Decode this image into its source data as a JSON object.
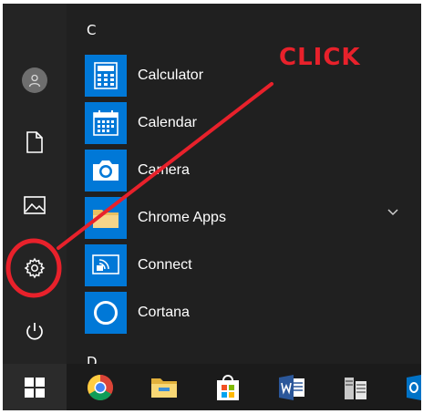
{
  "start_menu": {
    "sections": [
      {
        "letter": "C",
        "apps": [
          {
            "label": "Calculator",
            "icon": "calculator-icon"
          },
          {
            "label": "Calendar",
            "icon": "calendar-icon"
          },
          {
            "label": "Camera",
            "icon": "camera-icon"
          },
          {
            "label": "Chrome Apps",
            "icon": "folder-icon",
            "expandable": true
          },
          {
            "label": "Connect",
            "icon": "connect-icon"
          },
          {
            "label": "Cortana",
            "icon": "cortana-icon"
          }
        ]
      },
      {
        "letter": "D"
      }
    ],
    "rail": [
      "user-avatar-icon",
      "document-icon",
      "pictures-icon",
      "settings-icon",
      "power-icon"
    ]
  },
  "taskbar": {
    "apps": [
      "chrome-icon",
      "file-explorer-icon",
      "store-icon",
      "word-icon",
      "server-icon",
      "outlook-icon"
    ]
  },
  "annotation": {
    "text": "CLICK",
    "color": "#e8212b"
  },
  "colors": {
    "tile_blue": "#0078d7",
    "menu_bg": "#202020",
    "taskbar_bg": "#1b1b1b"
  }
}
